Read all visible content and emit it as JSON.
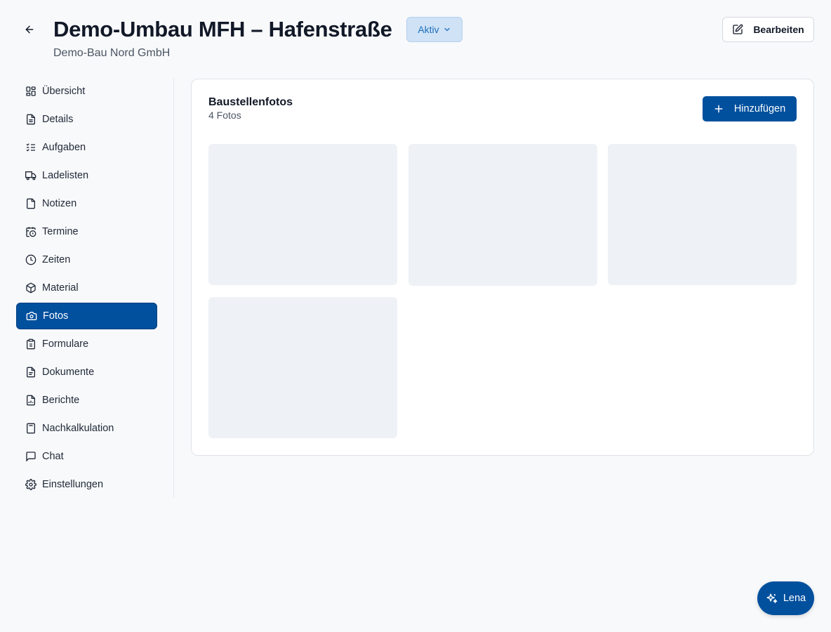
{
  "header": {
    "title": "Demo-Umbau MFH – Hafenstraße",
    "status": "Aktiv",
    "subtitle": "Demo-Bau Nord GmbH",
    "edit_label": "Bearbeiten"
  },
  "sidebar": {
    "items": [
      {
        "label": "Übersicht",
        "icon": "dashboard-icon"
      },
      {
        "label": "Details",
        "icon": "file-text-icon"
      },
      {
        "label": "Aufgaben",
        "icon": "checklist-icon"
      },
      {
        "label": "Ladelisten",
        "icon": "truck-icon"
      },
      {
        "label": "Notizen",
        "icon": "note-icon"
      },
      {
        "label": "Termine",
        "icon": "calendar-clock-icon"
      },
      {
        "label": "Zeiten",
        "icon": "clock-icon"
      },
      {
        "label": "Material",
        "icon": "package-icon"
      },
      {
        "label": "Fotos",
        "icon": "camera-icon",
        "active": true
      },
      {
        "label": "Formulare",
        "icon": "clipboard-icon"
      },
      {
        "label": "Dokumente",
        "icon": "document-icon"
      },
      {
        "label": "Berichte",
        "icon": "report-icon"
      },
      {
        "label": "Nachkalkulation",
        "icon": "calculator-icon"
      },
      {
        "label": "Chat",
        "icon": "chat-icon"
      },
      {
        "label": "Einstellungen",
        "icon": "gear-icon"
      }
    ]
  },
  "photos": {
    "title": "Baustellenfotos",
    "count": "4 Fotos",
    "add_label": "Hinzufügen"
  },
  "assistant": {
    "label": "Lena"
  },
  "colors": {
    "primary": "#00509e",
    "status_bg": "#cfe2f6",
    "status_text": "#1f6fba",
    "placeholder": "#eef1f5"
  }
}
